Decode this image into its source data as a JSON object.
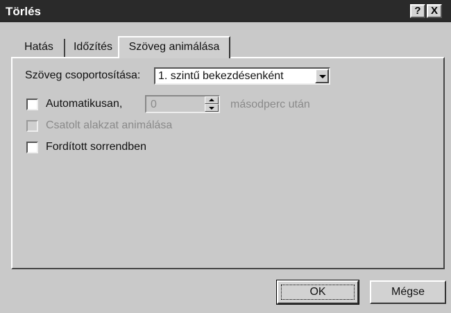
{
  "window": {
    "title": "Törlés",
    "help_label": "?",
    "close_label": "X"
  },
  "tabs": [
    {
      "label": "Hatás",
      "active": false
    },
    {
      "label": "Időzítés",
      "active": false
    },
    {
      "label": "Szöveg animálása",
      "active": true
    }
  ],
  "group_text": {
    "label": "Szöveg csoportosítása:",
    "selected": "1. szintű bekezdésenként"
  },
  "auto": {
    "label": "Automatikusan,",
    "checked": false,
    "value": "0",
    "unit": "másodperc után"
  },
  "attached_shape": {
    "label": "Csatolt alakzat animálása",
    "checked": false,
    "disabled": true
  },
  "reverse": {
    "label": "Fordított sorrendben",
    "checked": false
  },
  "buttons": {
    "ok": "OK",
    "cancel": "Mégse"
  }
}
